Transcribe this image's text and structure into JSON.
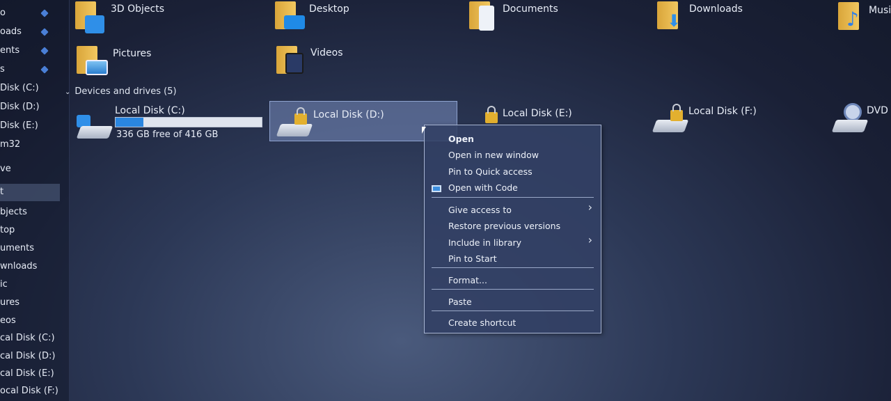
{
  "sidebar": {
    "items": [
      {
        "label": "o",
        "pinned": true
      },
      {
        "label": "oads",
        "pinned": true
      },
      {
        "label": "ents",
        "pinned": true
      },
      {
        "label": "s",
        "pinned": true
      },
      {
        "label": "Disk (C:)"
      },
      {
        "label": "Disk (D:)"
      },
      {
        "label": "Disk (E:)"
      },
      {
        "label": "m32"
      },
      {
        "label": "ve"
      },
      {
        "label": "t",
        "selected": true
      },
      {
        "label": "bjects"
      },
      {
        "label": "top"
      },
      {
        "label": "uments"
      },
      {
        "label": "wnloads"
      },
      {
        "label": "ic"
      },
      {
        "label": "ures"
      },
      {
        "label": "eos"
      },
      {
        "label": "cal Disk (C:)"
      },
      {
        "label": "cal Disk (D:)"
      },
      {
        "label": "cal Disk (E:)"
      },
      {
        "label": "ocal Disk (F:)"
      }
    ]
  },
  "folders": [
    {
      "label": "3D Objects",
      "icon": "3d-objects-folder-icon"
    },
    {
      "label": "Desktop",
      "icon": "desktop-folder-icon"
    },
    {
      "label": "Documents",
      "icon": "documents-folder-icon"
    },
    {
      "label": "Downloads",
      "icon": "downloads-folder-icon"
    },
    {
      "label": "Music",
      "icon": "music-folder-icon"
    },
    {
      "label": "Pictures",
      "icon": "pictures-folder-icon"
    },
    {
      "label": "Videos",
      "icon": "videos-folder-icon"
    }
  ],
  "devices": {
    "header": "Devices and drives (5)",
    "drives": [
      {
        "label": "Local Disk (C:)",
        "free_text": "336 GB free of 416 GB",
        "used_fraction": 0.19
      },
      {
        "label": "Local Disk (D:)",
        "locked": true,
        "selected": true
      },
      {
        "label": "Local Disk (E:)",
        "locked": true
      },
      {
        "label": "Local Disk (F:)",
        "locked": true
      },
      {
        "label": "DVD R",
        "icon": "dvd-drive-icon"
      }
    ]
  },
  "context_menu": {
    "items": [
      {
        "label": "Open",
        "bold": true
      },
      {
        "label": "Open in new window"
      },
      {
        "label": "Pin to Quick access"
      },
      {
        "label": "Open with Code",
        "icon": "vscode-icon"
      },
      {
        "label": "Give access to",
        "submenu": true
      },
      {
        "label": "Restore previous versions"
      },
      {
        "label": "Include in library",
        "submenu": true
      },
      {
        "label": "Pin to Start"
      },
      {
        "label": "Format..."
      },
      {
        "label": "Paste"
      },
      {
        "label": "Create shortcut"
      }
    ]
  },
  "colors": {
    "accent": "#2a86e0",
    "folder": "#f2c860",
    "lock": "#e3b02f"
  }
}
